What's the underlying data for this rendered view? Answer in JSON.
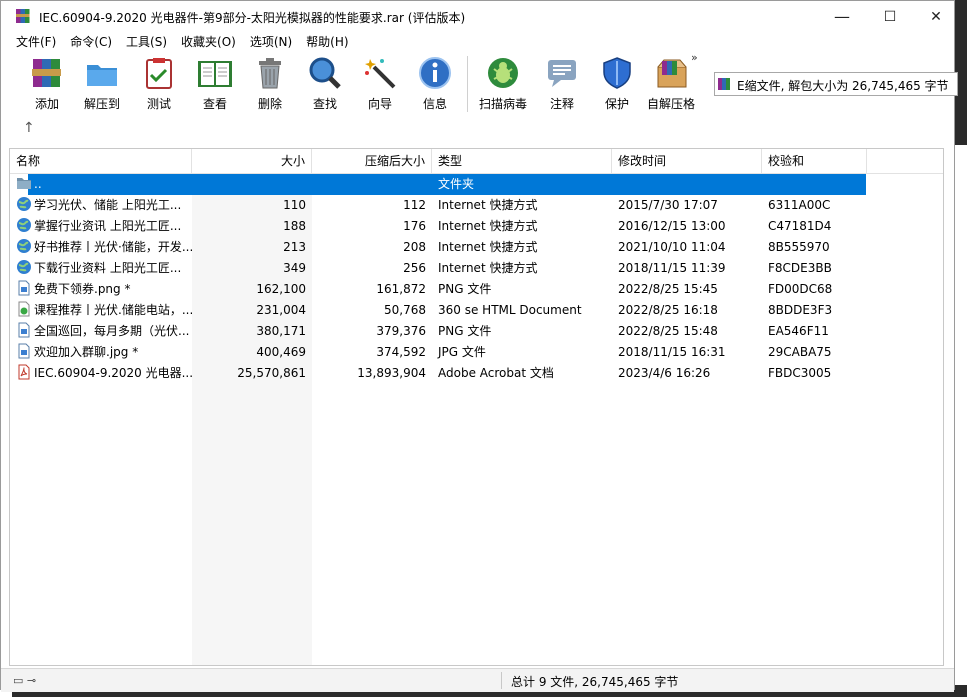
{
  "window": {
    "title": "IEC.60904-9.2020 光电器件-第9部分-太阳光模拟器的性能要求.rar (评估版本)",
    "minimize": "—",
    "maximize": "☐",
    "close": "✕"
  },
  "menu": [
    "文件(F)",
    "命令(C)",
    "工具(S)",
    "收藏夹(O)",
    "选项(N)",
    "帮助(H)"
  ],
  "toolbar": {
    "buttons": [
      {
        "label": "添加",
        "icon": "add-archive-icon"
      },
      {
        "label": "解压到",
        "icon": "extract-folder-icon"
      },
      {
        "label": "测试",
        "icon": "test-clipboard-icon"
      },
      {
        "label": "查看",
        "icon": "view-book-icon"
      },
      {
        "label": "删除",
        "icon": "trash-icon"
      },
      {
        "label": "查找",
        "icon": "magnifier-icon"
      },
      {
        "label": "向导",
        "icon": "wizard-wand-icon"
      },
      {
        "label": "信息",
        "icon": "info-icon"
      },
      {
        "label": "扫描病毒",
        "icon": "virus-scan-icon"
      },
      {
        "label": "注释",
        "icon": "comment-icon"
      },
      {
        "label": "保护",
        "icon": "shield-icon"
      },
      {
        "label": "自解压格",
        "icon": "sfx-box-icon"
      }
    ],
    "more": "»"
  },
  "info_box": {
    "text": "E缩文件, 解包大小为 26,745,465 字节"
  },
  "columns": [
    "名称",
    "大小",
    "压缩后大小",
    "类型",
    "修改时间",
    "校验和"
  ],
  "files": [
    {
      "name": "..",
      "size": "",
      "packed": "",
      "type": "文件夹",
      "modified": "",
      "crc": "",
      "icon": "folder-icon"
    },
    {
      "name": "学习光伏、储能 上阳光工...",
      "size": "110",
      "packed": "112",
      "type": "Internet 快捷方式",
      "modified": "2015/7/30 17:07",
      "crc": "6311A00C",
      "icon": "globe-icon"
    },
    {
      "name": "掌握行业资讯 上阳光工匠...",
      "size": "188",
      "packed": "176",
      "type": "Internet 快捷方式",
      "modified": "2016/12/15 13:00",
      "crc": "C47181D4",
      "icon": "globe-icon"
    },
    {
      "name": "好书推荐丨光伏·储能，开发...",
      "size": "213",
      "packed": "208",
      "type": "Internet 快捷方式",
      "modified": "2021/10/10 11:04",
      "crc": "8B555970",
      "icon": "globe-icon"
    },
    {
      "name": "下载行业资料 上阳光工匠...",
      "size": "349",
      "packed": "256",
      "type": "Internet 快捷方式",
      "modified": "2018/11/15 11:39",
      "crc": "F8CDE3BB",
      "icon": "globe-icon"
    },
    {
      "name": "免费下领券.png *",
      "size": "162,100",
      "packed": "161,872",
      "type": "PNG 文件",
      "modified": "2022/8/25 15:45",
      "crc": "FD00DC68",
      "icon": "image-file-icon"
    },
    {
      "name": "课程推荐丨光伏.储能电站，...",
      "size": "231,004",
      "packed": "50,768",
      "type": "360 se HTML Document",
      "modified": "2022/8/25 16:18",
      "crc": "8BDDE3F3",
      "icon": "html-file-icon"
    },
    {
      "name": "全国巡回，每月多期（光伏...",
      "size": "380,171",
      "packed": "379,376",
      "type": "PNG 文件",
      "modified": "2022/8/25 15:48",
      "crc": "EA546F11",
      "icon": "image-file-icon"
    },
    {
      "name": "欢迎加入群聊.jpg *",
      "size": "400,469",
      "packed": "374,592",
      "type": "JPG 文件",
      "modified": "2018/11/15 16:31",
      "crc": "29CABA75",
      "icon": "image-file-icon"
    },
    {
      "name": "IEC.60904-9.2020 光电器...",
      "size": "25,570,861",
      "packed": "13,893,904",
      "type": "Adobe Acrobat 文档",
      "modified": "2023/4/6 16:26",
      "crc": "FBDC3005",
      "icon": "pdf-file-icon"
    }
  ],
  "status": {
    "text": "总计 9 文件, 26,745,465 字节"
  },
  "colors": {
    "selection": "#0078d7",
    "accent": "#1a5aa6"
  }
}
